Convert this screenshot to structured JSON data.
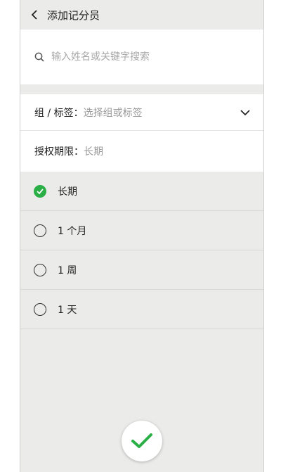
{
  "header": {
    "title": "添加记分员",
    "back_icon": "chevron-left-icon"
  },
  "search": {
    "placeholder": "输入姓名或关键字搜索",
    "icon": "search-icon"
  },
  "group": {
    "label": "组 / 标签：",
    "value": "选择组或标签",
    "icon": "chevron-down-icon"
  },
  "authorization": {
    "label": "授权期限：",
    "value": "长期"
  },
  "options": [
    {
      "label": "长期",
      "selected": true
    },
    {
      "label": "1 个月",
      "selected": false
    },
    {
      "label": "1 周",
      "selected": false
    },
    {
      "label": "1 天",
      "selected": false
    }
  ],
  "confirm": {
    "icon": "check-icon"
  },
  "colors": {
    "accent": "#2aae46",
    "background": "#ebebea"
  }
}
